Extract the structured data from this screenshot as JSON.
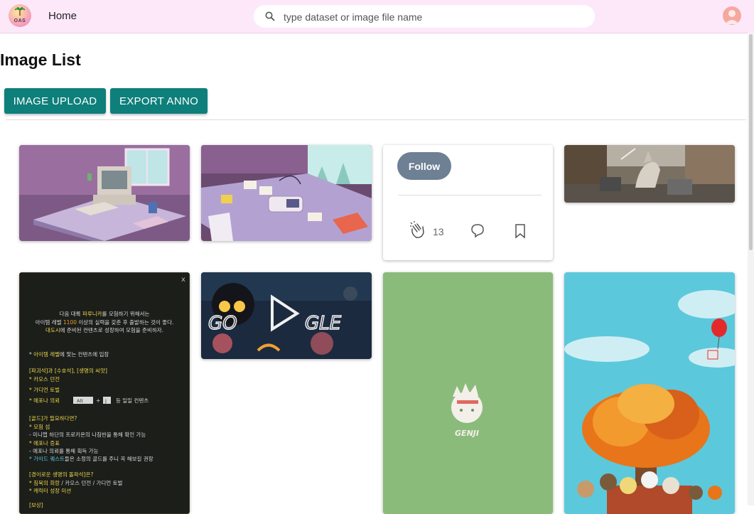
{
  "header": {
    "logo_text": "OAS",
    "home_label": "Home",
    "search_placeholder": "type dataset or image file name"
  },
  "page": {
    "title": "Image List",
    "buttons": {
      "upload": "IMAGE UPLOAD",
      "export": "EXPORT ANNO"
    }
  },
  "social_card": {
    "follow_label": "Follow",
    "clap_count": "13"
  },
  "images": [
    {
      "name": "isometric-retro-computer-desk"
    },
    {
      "name": "isometric-gameboy-desk"
    },
    {
      "name": "horse-rider-street-painting"
    },
    {
      "name": "game-notice-dark-panel"
    },
    {
      "name": "google-halloween-doodle"
    },
    {
      "name": "genji-logo-green"
    },
    {
      "name": "autumn-tree-animal-crossing"
    }
  ],
  "game_notice": {
    "close_glyph": "x",
    "intro1_pre": "다음 대륙 ",
    "intro1_hl": "파루니카",
    "intro1_post": "를 모험하기 위해서는",
    "intro2_pre": "아이템 레벨 ",
    "intro2_hl": "1100",
    "intro2_post": " 이상의 실력을 갖춘 후 출발하는 것이 좋다.",
    "intro3_hl": "대도시",
    "intro3_post": "에 준비된 컨텐츠로 성장하여 모험을 준비하자.",
    "b1_pre": "* ",
    "b1_hl": "아이템 레벨",
    "b1_post": "에 맞는 컨텐츠에 입장",
    "h1": "[파괴석]과 [수호석], [생명의 씨앗]",
    "i1": "* 카오스 던전",
    "i2": "* 가디언 토벌",
    "i3_hl": "* 에포나 의뢰",
    "i3_key1": "Alt",
    "i3_key2": "J",
    "i3_post": "등 일일 컨텐츠",
    "h2": "[골드]가 필요하다면?",
    "i4": "* 모험 섬",
    "i5": "- 미니맵 하단의 프로키온의 나침반을 통해 확인 가능",
    "i6": "* 에포나 증표",
    "i7": "- 에포나 의뢰를 통해 획득 가능",
    "i8_hl": "* 가이드 퀘스트",
    "i8_post": "들은 소정의 골드를 주니 꼭 해보길 권장",
    "h3": "[경이로운 생명의 돌파석]은?",
    "i9_hl": "* 침묵의 회랑",
    "i9_post": " / 카오스 던전 / 가디언 토벌",
    "i10": "* 캐릭터 성장 미션",
    "h4": "[보상]"
  },
  "doodle": {
    "letters_left": "GO",
    "letters_right": "GLE"
  },
  "genji": {
    "label": "GENJI"
  }
}
